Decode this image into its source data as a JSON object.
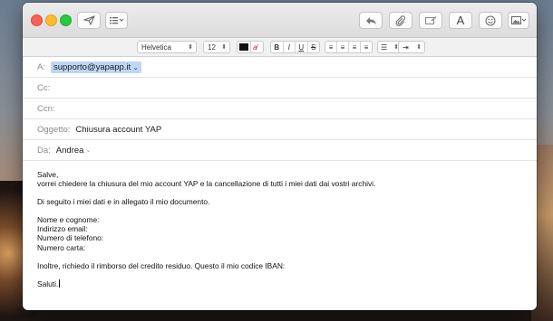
{
  "format": {
    "font_name": "Helvetica",
    "font_size": "12"
  },
  "headers": {
    "to_label": "A:",
    "to_value": "supporto@yapapp.it",
    "cc_label": "Cc:",
    "bcc_label": "Ccn:",
    "subject_label": "Oggetto:",
    "subject_value": "Chiusura account YAP",
    "from_label": "Da:",
    "from_value": "Andrea"
  },
  "body": {
    "lines": [
      "Salve,",
      "vorrei chiedere la chiusura del mio account YAP e la cancellazione di tutti i miei dati dai vostri archivi.",
      "",
      "Di seguito i miei dati e in allegato il mio documento.",
      "",
      "Nome e cognome:",
      "Indirizzo email:",
      "Numero di telefono:",
      "Numero carta:",
      "",
      "Inoltre, richiedo il rimborso del credito residuo. Questo il mio codice IBAN:",
      "",
      "Saluti."
    ]
  },
  "colors": {
    "recipient_token": "#bcd7f4",
    "close": "#fc5f57",
    "minimize": "#fdbc2e",
    "maximize": "#29c840"
  }
}
